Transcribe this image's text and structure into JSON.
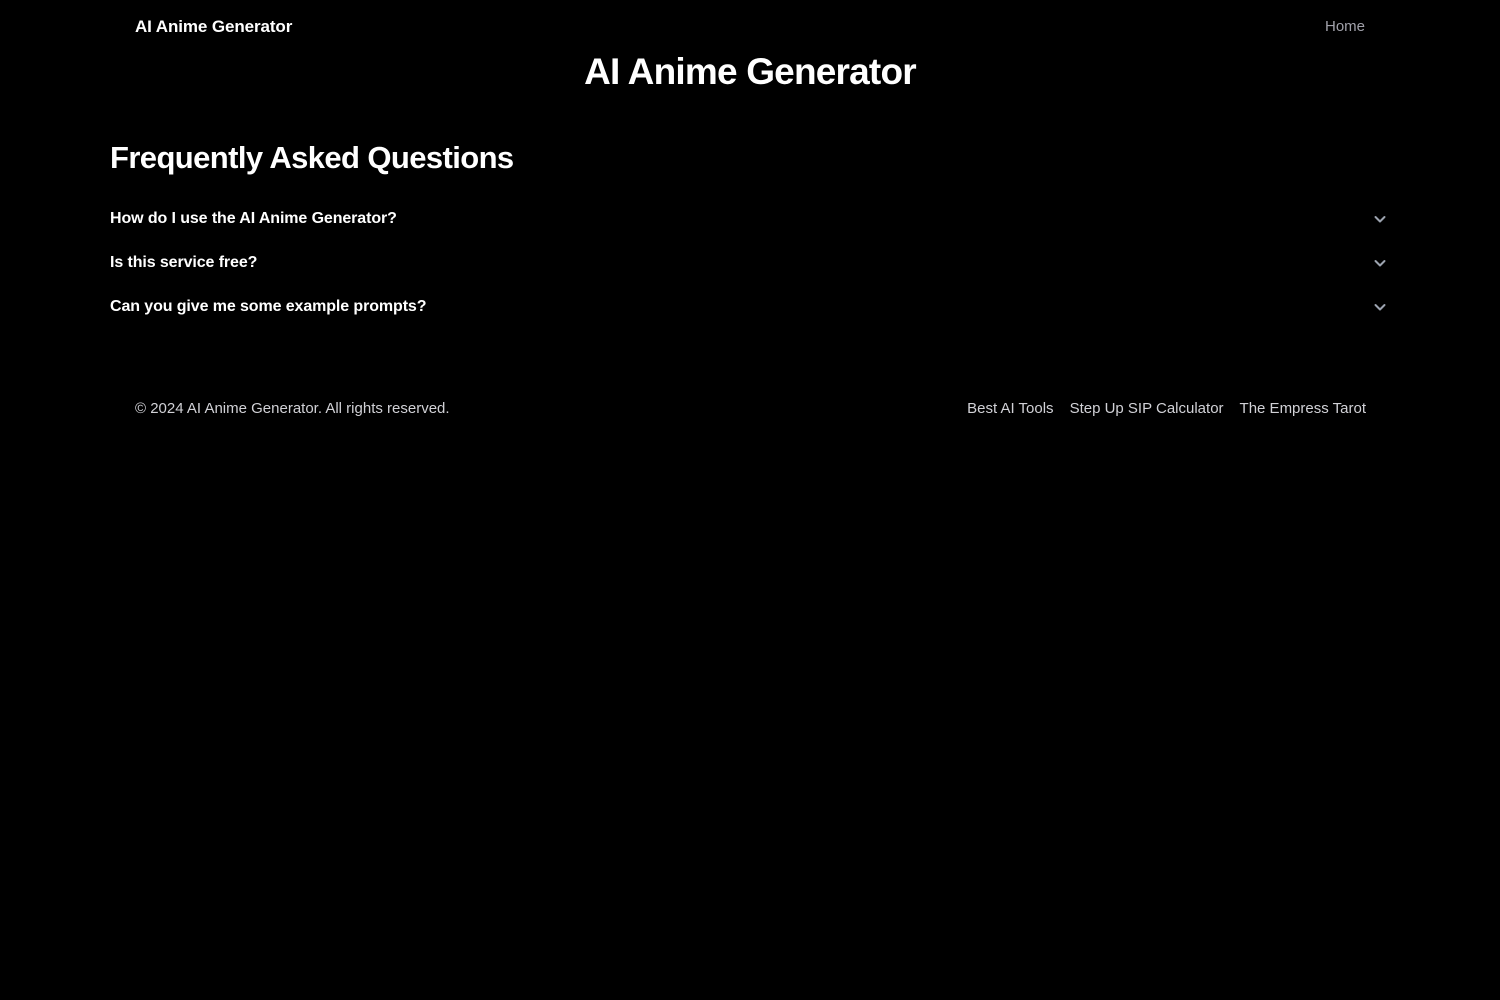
{
  "theme": {
    "background": "#000000",
    "text_primary": "#ffffff",
    "text_muted": "#a1a1aa",
    "text_footer": "#d1d1d6",
    "icon_color": "#9ca3af"
  },
  "header": {
    "brand": "AI Anime Generator",
    "nav": [
      {
        "label": "Home",
        "name": "nav-link-home"
      }
    ]
  },
  "hero": {
    "title": "AI Anime Generator"
  },
  "faq": {
    "heading": "Frequently Asked Questions",
    "items": [
      {
        "question": "How do I use the AI Anime Generator?",
        "expanded": false,
        "icon": "chevron-down-icon"
      },
      {
        "question": "Is this service free?",
        "expanded": false,
        "icon": "chevron-down-icon"
      },
      {
        "question": "Can you give me some example prompts?",
        "expanded": false,
        "icon": "chevron-down-icon"
      }
    ]
  },
  "footer": {
    "copyright": "© 2024 AI Anime Generator. All rights reserved.",
    "links": [
      {
        "label": "Best AI Tools",
        "name": "footer-link-best-ai-tools"
      },
      {
        "label": "Step Up SIP Calculator",
        "name": "footer-link-step-up-sip-calculator"
      },
      {
        "label": "The Empress Tarot",
        "name": "footer-link-the-empress-tarot"
      }
    ]
  }
}
